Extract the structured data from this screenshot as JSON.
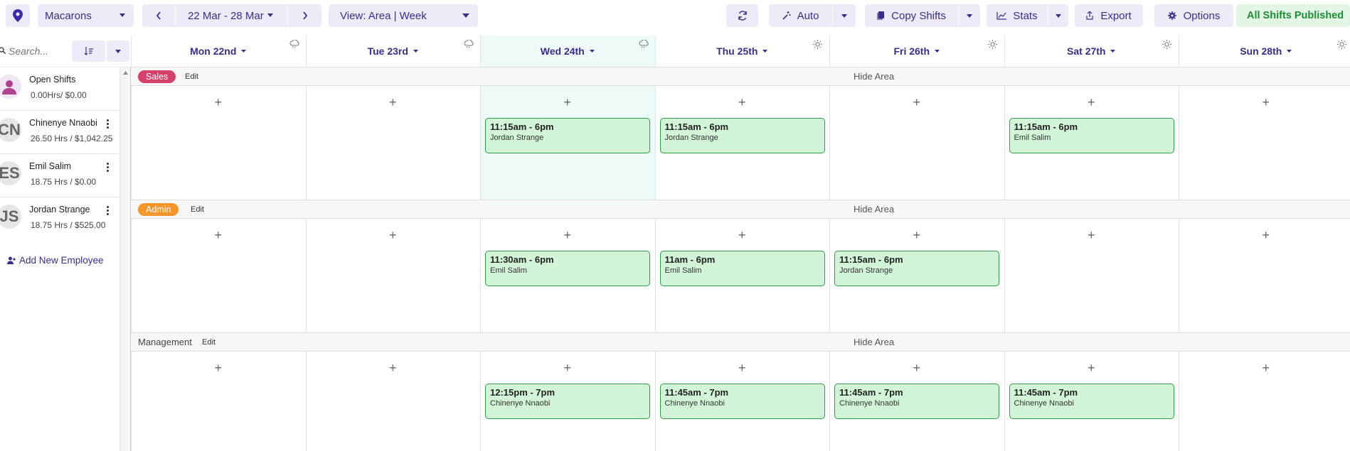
{
  "toolbar": {
    "location": "Macarons",
    "date_range": "22 Mar - 28 Mar",
    "view": "View: Area | Week",
    "auto": "Auto",
    "copy_shifts": "Copy Shifts",
    "stats": "Stats",
    "export": "Export",
    "options": "Options",
    "published": "All Shifts Published"
  },
  "sidebar": {
    "search_placeholder": "Search...",
    "employees": [
      {
        "initials": "",
        "name": "Open Shifts",
        "hours": "0.00Hrs/ $0.00"
      },
      {
        "initials": "CN",
        "name": "Chinenye Nnaobi",
        "hours": "26.50 Hrs / $1,042.25"
      },
      {
        "initials": "ES",
        "name": "Emil Salim",
        "hours": "18.75 Hrs / $0.00"
      },
      {
        "initials": "JS",
        "name": "Jordan Strange",
        "hours": "18.75 Hrs / $525.00"
      }
    ],
    "add_employee": "Add New Employee"
  },
  "days": [
    "Mon 22nd",
    "Tue 23rd",
    "Wed 24th",
    "Thu 25th",
    "Fri 26th",
    "Sat 27th",
    "Sun 28th"
  ],
  "weather": [
    "cloud-rain",
    "cloud-rain",
    "cloud-rain",
    "sun",
    "sun",
    "sun",
    "sun"
  ],
  "areas": [
    {
      "name": "Sales",
      "edit": "Edit",
      "hide": "Hide Area",
      "shifts": [
        {
          "day": 2,
          "time": "11:15am - 6pm",
          "employee": "Jordan Strange"
        },
        {
          "day": 3,
          "time": "11:15am - 6pm",
          "employee": "Jordan Strange"
        },
        {
          "day": 5,
          "time": "11:15am - 6pm",
          "employee": "Emil Salim"
        }
      ]
    },
    {
      "name": "Admin",
      "edit": "Edit",
      "hide": "Hide Area",
      "shifts": [
        {
          "day": 2,
          "time": "11:30am - 6pm",
          "employee": "Emil Salim"
        },
        {
          "day": 3,
          "time": "11am - 6pm",
          "employee": "Emil Salim"
        },
        {
          "day": 4,
          "time": "11:15am - 6pm",
          "employee": "Jordan Strange"
        }
      ]
    },
    {
      "name": "Management",
      "edit": "Edit",
      "hide": "Hide Area",
      "shifts": [
        {
          "day": 2,
          "time": "12:15pm - 7pm",
          "employee": "Chinenye Nnaobi"
        },
        {
          "day": 3,
          "time": "11:45am - 7pm",
          "employee": "Chinenye Nnaobi"
        },
        {
          "day": 4,
          "time": "11:45am - 7pm",
          "employee": "Chinenye Nnaobi"
        },
        {
          "day": 5,
          "time": "11:45am - 7pm",
          "employee": "Chinenye Nnaobi"
        }
      ]
    }
  ],
  "colors": {
    "accent": "#3a2c8f",
    "sales_badge": "#d7406b",
    "admin_badge": "#f5962c",
    "shift_bg": "#d2f4d8",
    "shift_border": "#2f9b45",
    "today_bg": "#eefafa"
  }
}
